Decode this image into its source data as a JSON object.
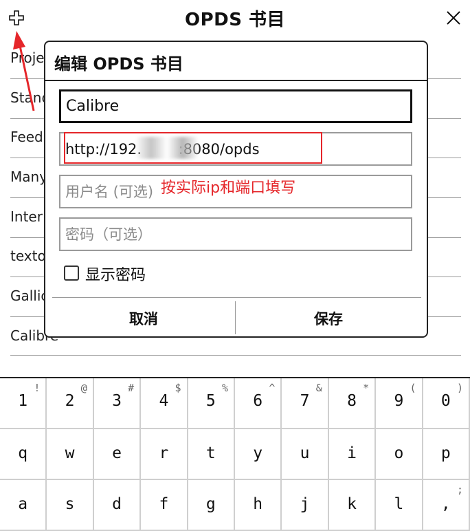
{
  "header": {
    "title": "OPDS 书目",
    "add_icon": "plus-outline-icon",
    "close_icon": "close-icon"
  },
  "background_list": [
    "Proje",
    "Stand",
    "Feed",
    "Many",
    "Inter",
    "texto",
    "Gallic",
    "Calibre"
  ],
  "dialog": {
    "title": "编辑 OPDS 书目",
    "name_value": "Calibre",
    "url_value": "http://192.        :8080/opds",
    "username_placeholder": "用户名 (可选)",
    "password_placeholder": "密码（可选）",
    "show_password_label": "显示密码",
    "cancel_label": "取消",
    "save_label": "保存"
  },
  "annotation": {
    "note": "按实际ip和端口填写",
    "color": "#e5262a"
  },
  "keyboard": {
    "row1": [
      {
        "key": "1",
        "sub": "!"
      },
      {
        "key": "2",
        "sub": "@"
      },
      {
        "key": "3",
        "sub": "#"
      },
      {
        "key": "4",
        "sub": "$"
      },
      {
        "key": "5",
        "sub": "%"
      },
      {
        "key": "6",
        "sub": "^"
      },
      {
        "key": "7",
        "sub": "&"
      },
      {
        "key": "8",
        "sub": "*"
      },
      {
        "key": "9",
        "sub": "("
      },
      {
        "key": "0",
        "sub": ")"
      }
    ],
    "row2": [
      {
        "key": "q",
        "sub": ""
      },
      {
        "key": "w",
        "sub": ""
      },
      {
        "key": "e",
        "sub": ""
      },
      {
        "key": "r",
        "sub": ""
      },
      {
        "key": "t",
        "sub": ""
      },
      {
        "key": "y",
        "sub": ""
      },
      {
        "key": "u",
        "sub": ""
      },
      {
        "key": "i",
        "sub": ""
      },
      {
        "key": "o",
        "sub": ""
      },
      {
        "key": "p",
        "sub": ""
      }
    ],
    "row3": [
      {
        "key": "a",
        "sub": ""
      },
      {
        "key": "s",
        "sub": ""
      },
      {
        "key": "d",
        "sub": ""
      },
      {
        "key": "f",
        "sub": ""
      },
      {
        "key": "g",
        "sub": ""
      },
      {
        "key": "h",
        "sub": ""
      },
      {
        "key": "j",
        "sub": ""
      },
      {
        "key": "k",
        "sub": ""
      },
      {
        "key": "l",
        "sub": ""
      },
      {
        "key": ",",
        "sub": ";"
      }
    ]
  }
}
